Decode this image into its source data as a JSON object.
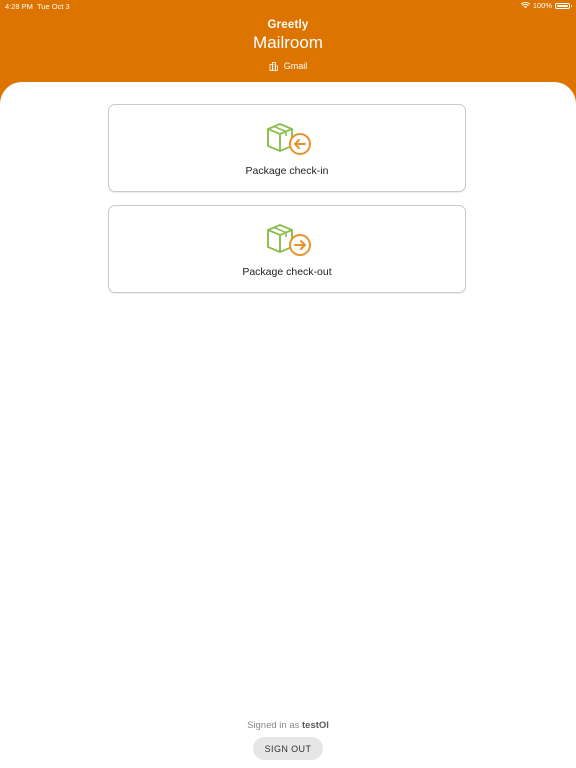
{
  "status_bar": {
    "time": "4:28 PM",
    "date": "Tue Oct 3",
    "battery": "100%",
    "battery_level": 1.0
  },
  "header": {
    "brand": "Greetly",
    "title": "Mailroom",
    "account": "Gmail",
    "account_icon": "building-icon",
    "background_color": "#dd7400"
  },
  "actions": [
    {
      "label": "Package check-in",
      "icon": "package-check-in-icon"
    },
    {
      "label": "Package check-out",
      "icon": "package-check-out-icon"
    }
  ],
  "footer": {
    "signed_in_prefix": "Signed in as",
    "username": "testOl",
    "sign_out_label": "SIGN OUT"
  },
  "colors": {
    "accent": "#dd7400",
    "box_green": "#8cc152",
    "arrow_orange": "#e8922c"
  }
}
